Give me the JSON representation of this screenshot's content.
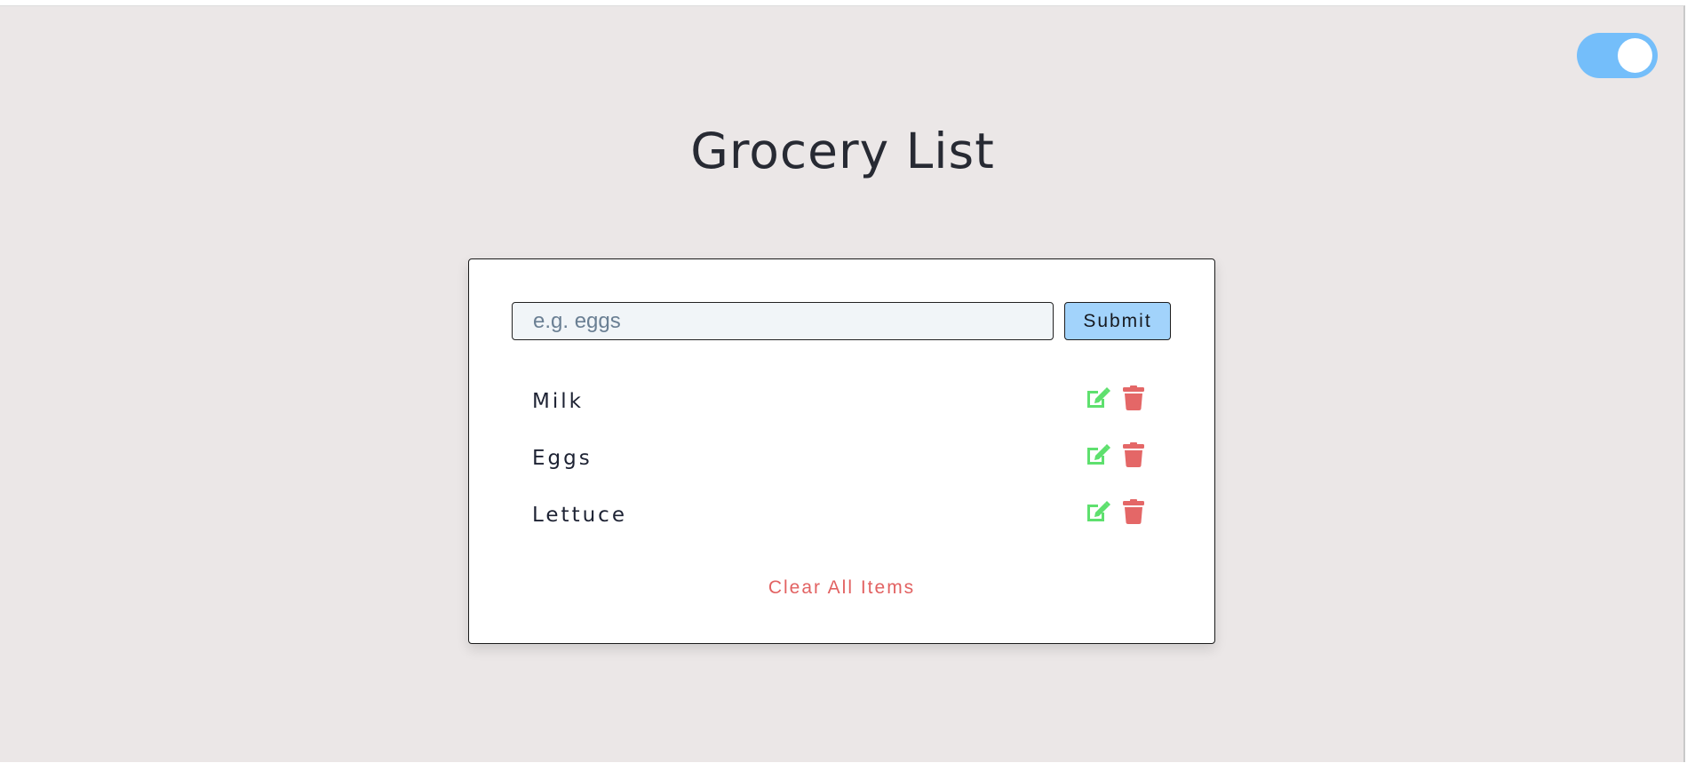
{
  "app": {
    "title": "Grocery List",
    "theme_toggle": {
      "state": "on",
      "icon": "toggle-switch",
      "color": "#74befa"
    }
  },
  "form": {
    "input_placeholder": "e.g. eggs",
    "input_value": "",
    "submit_label": "Submit",
    "submit_color": "#a2d3fb"
  },
  "items": [
    {
      "name": "Milk",
      "edit_icon": "edit-icon",
      "delete_icon": "trash-icon"
    },
    {
      "name": "Eggs",
      "edit_icon": "edit-icon",
      "delete_icon": "trash-icon"
    },
    {
      "name": "Lettuce",
      "edit_icon": "edit-icon",
      "delete_icon": "trash-icon"
    }
  ],
  "clear_label": "Clear All Items",
  "colors": {
    "background": "#ebe7e7",
    "edit": "#5ee06e",
    "delete": "#e46767",
    "clear": "#e26262"
  }
}
